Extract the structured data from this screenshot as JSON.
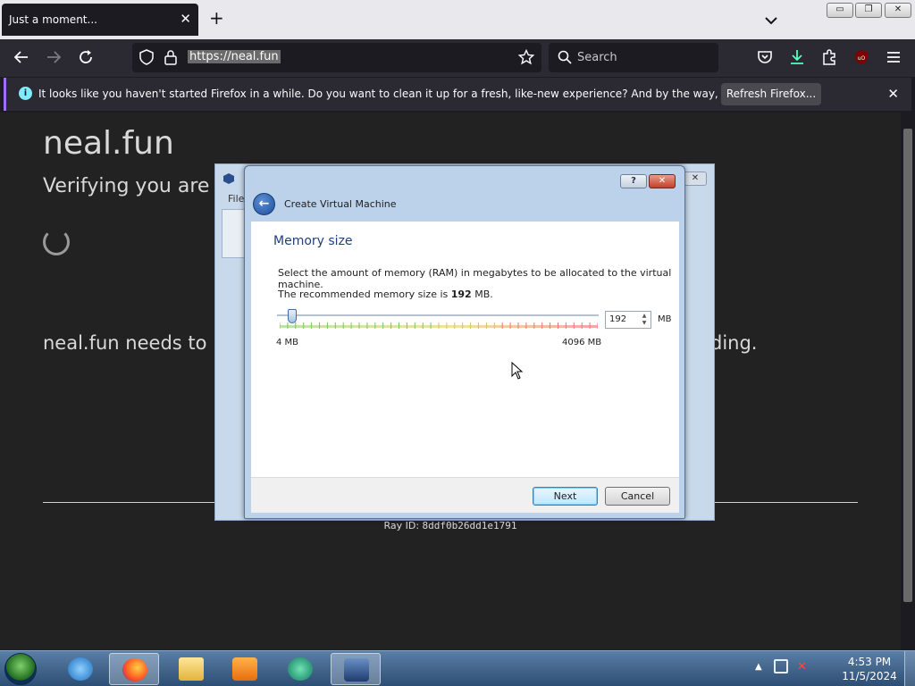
{
  "browser": {
    "tab_title": "Just a moment...",
    "tab_close": "✕",
    "new_tab": "+",
    "url": "https://neal.fun",
    "search_placeholder": "Search"
  },
  "notification": {
    "message": "It looks like you haven't started Firefox in a while. Do you want to clean it up for a fresh, like-new experience? And by the way, welcome back!",
    "button": "Refresh Firefox...",
    "close": "✕"
  },
  "page": {
    "site_title": "neal.fun",
    "verifying": "Verifying you are h",
    "needs_left": "neal.fun needs to r",
    "needs_right": "ding.",
    "ray_label": "Ray ID: ",
    "ray_id": "8ddf0b26dd1e1791"
  },
  "vbox_bg": {
    "menu": "File"
  },
  "dialog": {
    "title": "Create Virtual Machine",
    "help": "?",
    "close": "✕",
    "section_title": "Memory size",
    "description": "Select the amount of memory (RAM) in megabytes to be allocated to the virtual machine.",
    "recommended_prefix": "The recommended memory size is ",
    "recommended_value": "192",
    "recommended_suffix": " MB.",
    "min_label": "4 MB",
    "max_label": "4096 MB",
    "memory_value": "192",
    "unit": "MB",
    "slider": {
      "min": 4,
      "max": 4096,
      "value": 192
    },
    "next": "Next",
    "cancel": "Cancel"
  },
  "taskbar": {
    "items": [
      "internet-explorer",
      "firefox",
      "file-explorer",
      "media-player",
      "app-globe",
      "virtualbox"
    ],
    "tray_arrow": "▲",
    "volume_muted": "✕",
    "time": "4:53 PM",
    "date": "11/5/2024"
  },
  "colors": {
    "firefox_dark": "#1c1b22",
    "dialog_accent": "#1e3f7a",
    "notification_accent": "#a36bff"
  }
}
